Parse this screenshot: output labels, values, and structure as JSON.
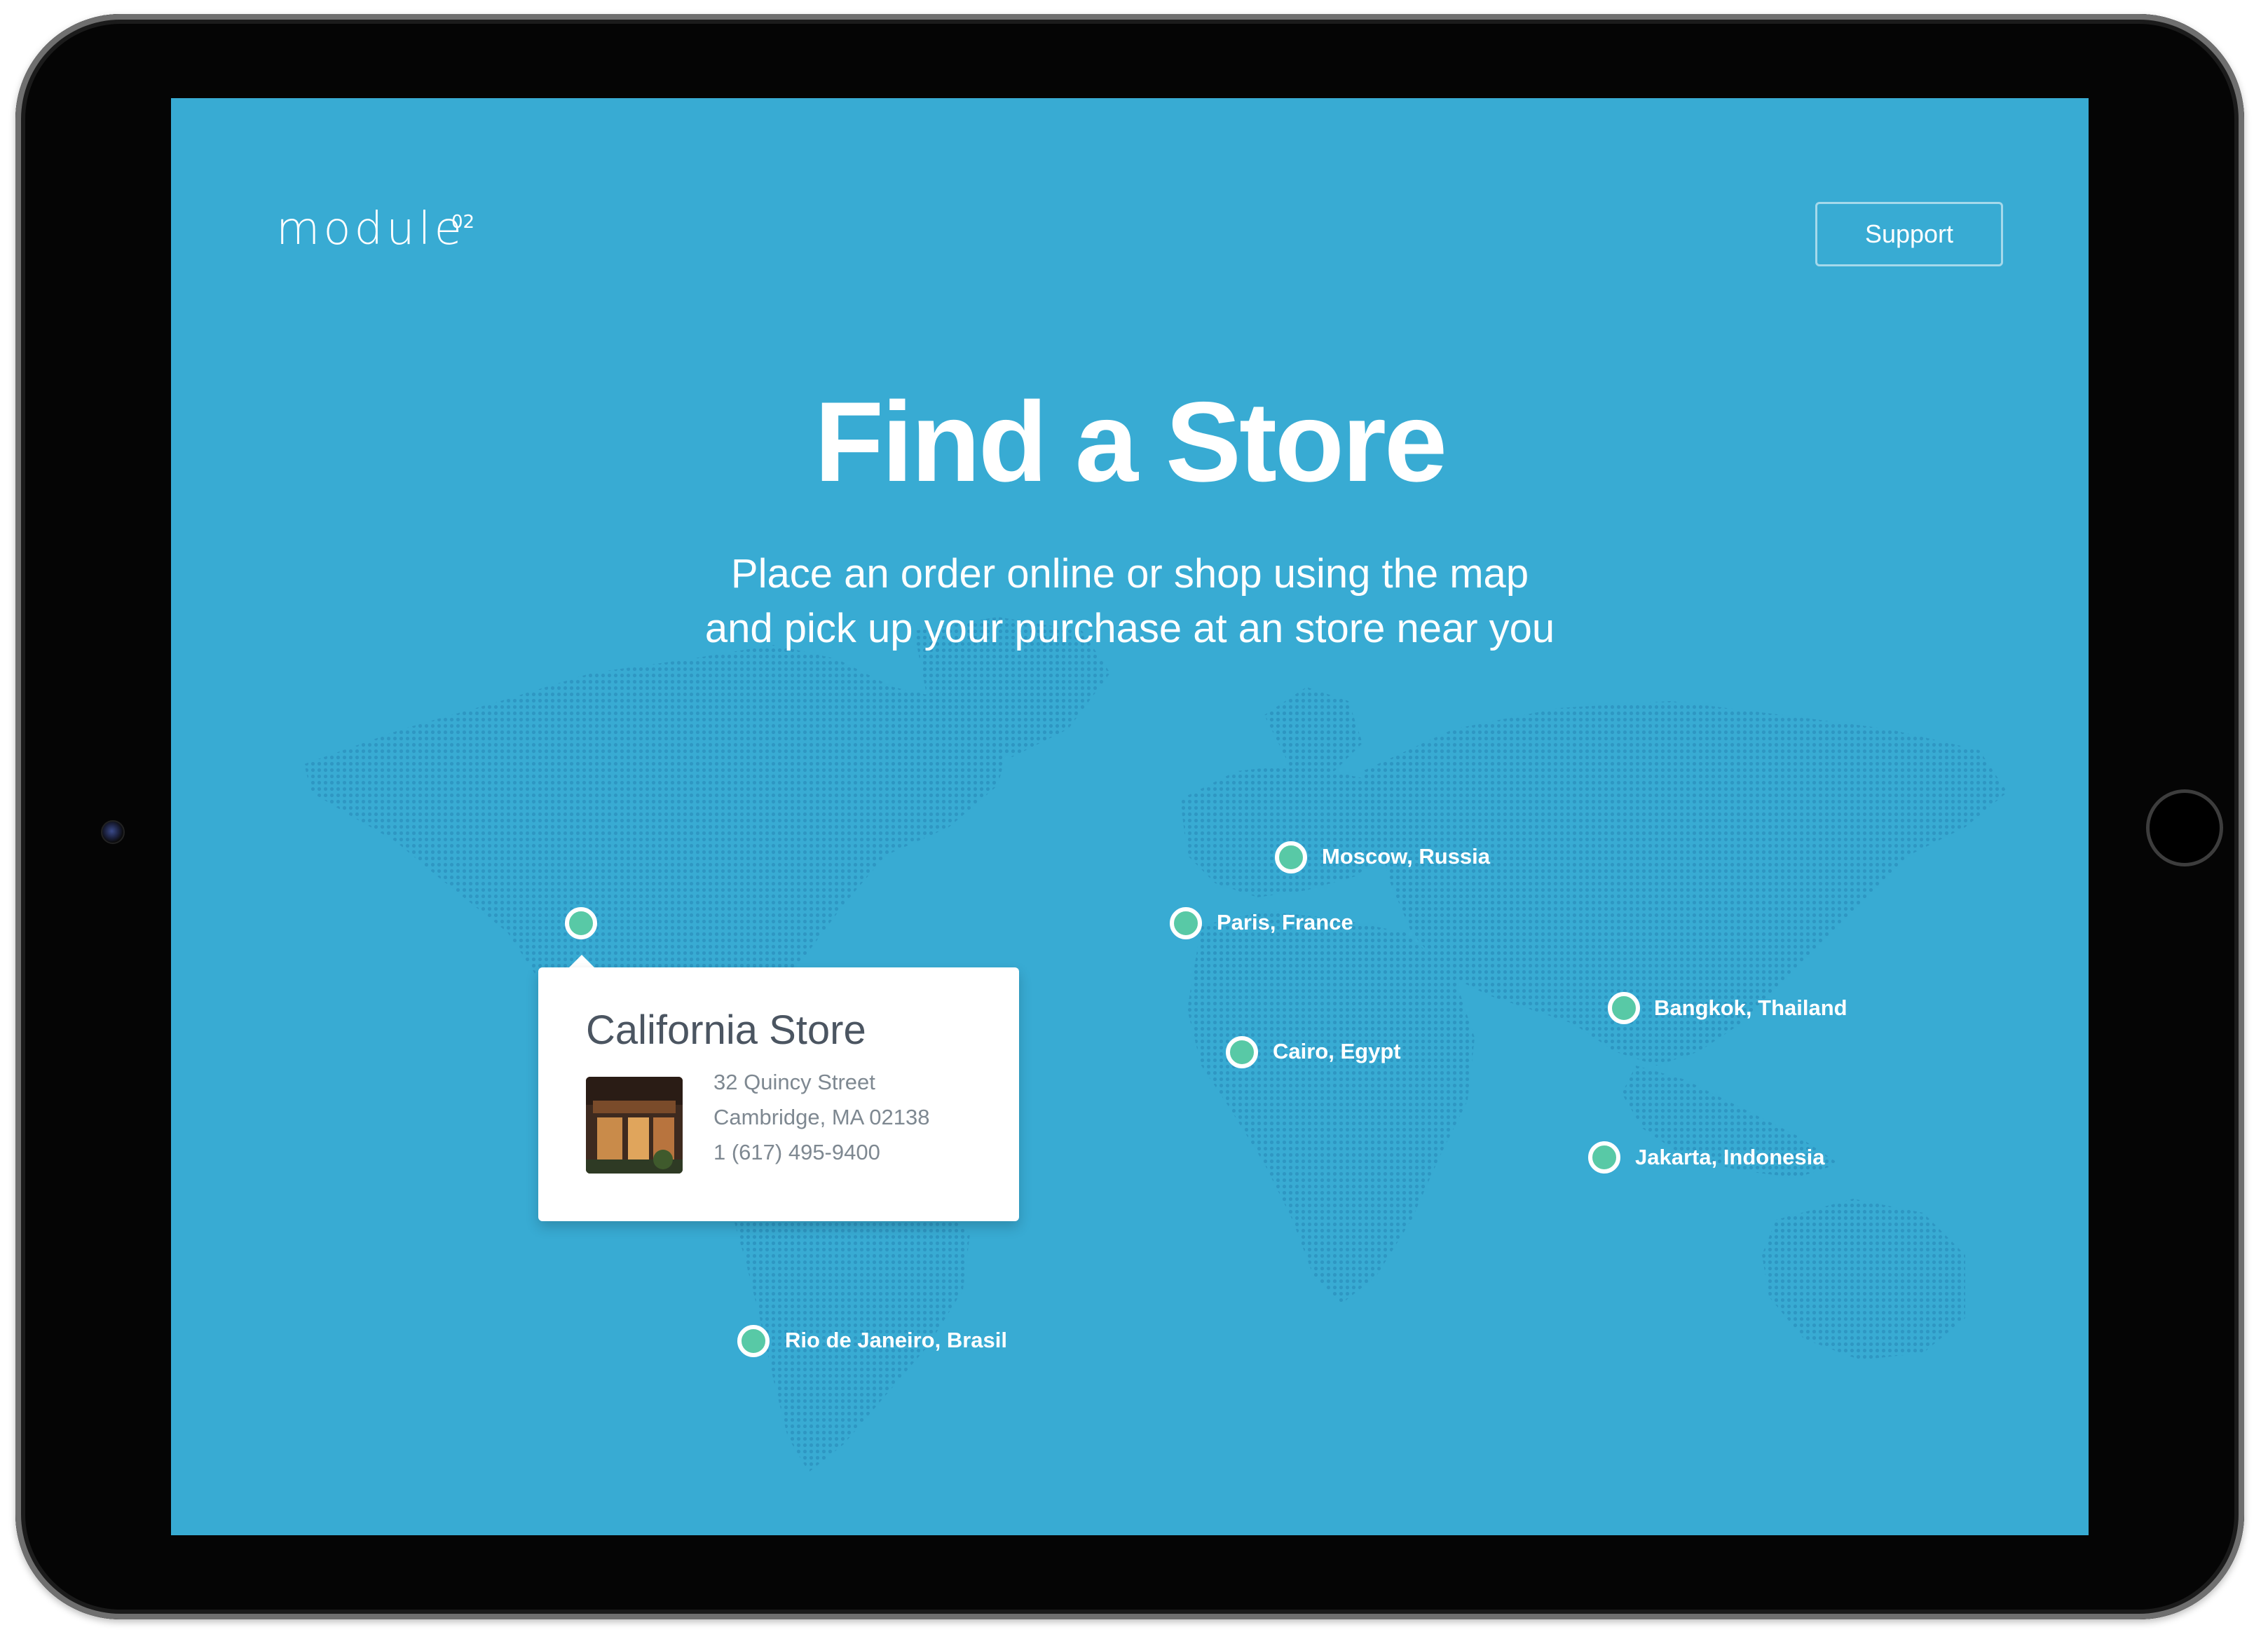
{
  "app": {
    "logo_text": "module",
    "logo_superscript": "02",
    "support_label": "Support"
  },
  "hero": {
    "title": "Find a Store",
    "subtitle_line1": "Place an order online or shop using the map",
    "subtitle_line2": "and pick up your purchase at an store near you"
  },
  "locations": [
    {
      "label": "Moscow, Russia"
    },
    {
      "label": "Paris, France"
    },
    {
      "label": "Bangkok, Thailand"
    },
    {
      "label": "Cairo, Egypt"
    },
    {
      "label": "Jakarta, Indonesia"
    },
    {
      "label": "Rio de Janeiro, Brasil"
    }
  ],
  "popup": {
    "title": "California Store",
    "address_line1": "32 Quincy Street",
    "address_line2": "Cambridge, MA 02138",
    "phone": "1 (617) 495-9400"
  },
  "colors": {
    "screen_bg": "#38abd3",
    "pin_fill": "#58c9a6",
    "map_dots": "#2f98c4"
  },
  "icons": [
    "location-pin-icon"
  ]
}
